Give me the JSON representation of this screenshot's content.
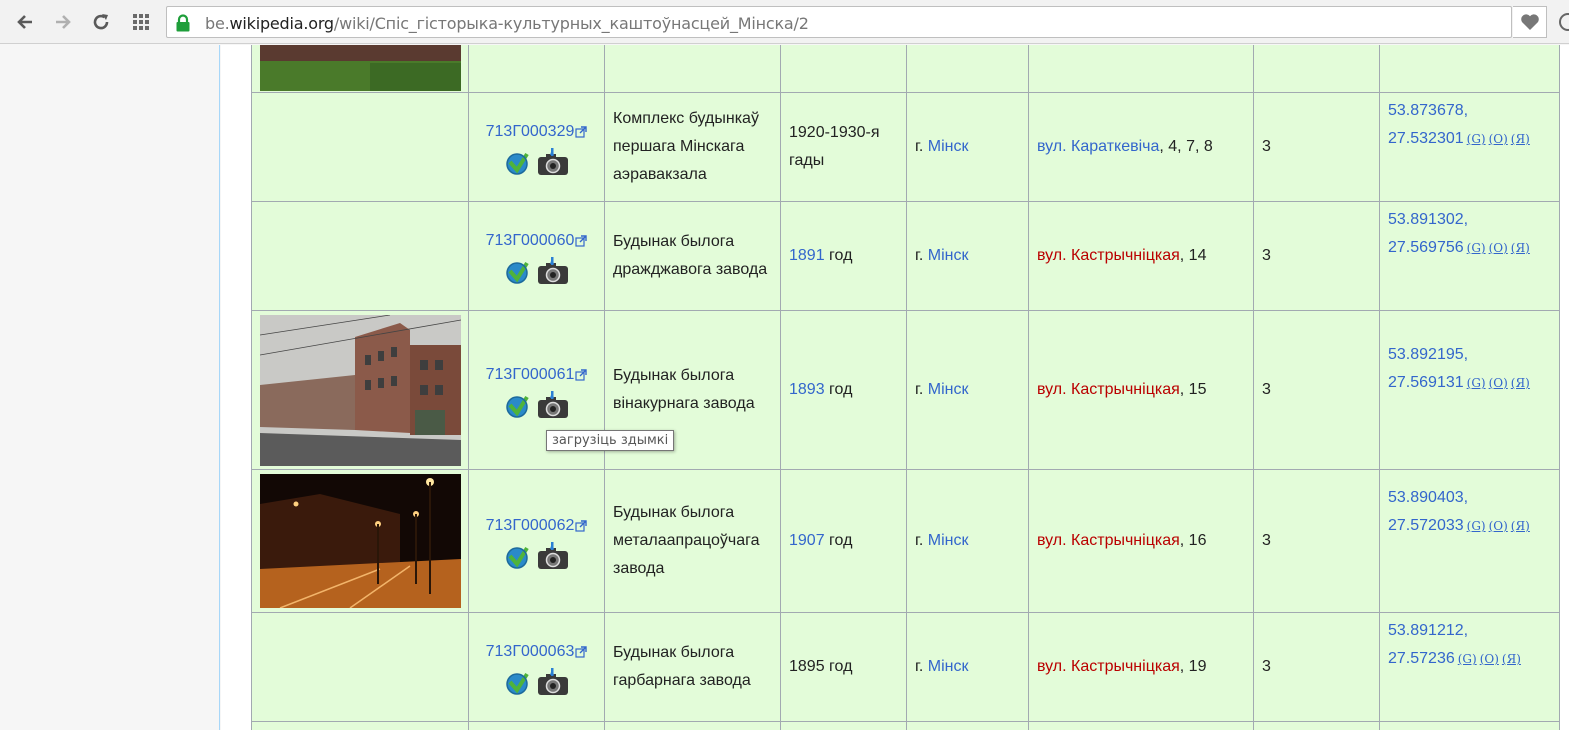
{
  "browser": {
    "url_prefix": "be.",
    "url_domain": "wikipedia.org",
    "url_path": "/wiki/Спіс_гісторыка-культурных_каштоўнасцей_Мінска/2"
  },
  "tooltip": "загрузіць здымкі",
  "coord_links": {
    "g": "(G)",
    "o": "(O)",
    "y": "(Я)"
  },
  "rows": [
    {
      "id": "713Г000329",
      "name": "Комплекс будынкаў першага Мінскага аэравакзала",
      "date_link": "",
      "date_text": "1920-1930-я гады",
      "city_prefix": "г. ",
      "city": "Мінск",
      "street": "вул. Караткевіча",
      "number": ", 4, 7, 8",
      "category": "3",
      "lat": "53.873678,",
      "lon": "27.532301"
    },
    {
      "id": "713Г000060",
      "name": "Будынак былога дражджавога завода",
      "date_link": "1891",
      "date_text": " год",
      "city_prefix": "г. ",
      "city": "Мінск",
      "street": "вул. Кастрычніцкая",
      "number": ", 14",
      "category": "3",
      "lat": "53.891302,",
      "lon": "27.569756"
    },
    {
      "id": "713Г000061",
      "name": "Будынак былога вінакурнага завода",
      "date_link": "1893",
      "date_text": " год",
      "city_prefix": "г. ",
      "city": "Мінск",
      "street": "вул. Кастрычніцкая",
      "number": ", 15",
      "category": "3",
      "lat": "53.892195,",
      "lon": "27.569131"
    },
    {
      "id": "713Г000062",
      "name": "Будынак былога металаапрацоўчага завода",
      "date_link": "1907",
      "date_text": " год",
      "city_prefix": "г. ",
      "city": "Мінск",
      "street": "вул. Кастрычніцкая",
      "number": ", 16",
      "category": "3",
      "lat": "53.890403,",
      "lon": "27.572033"
    },
    {
      "id": "713Г000063",
      "name": "Будынак былога гарбарнага завода",
      "date_link": "",
      "date_text": "1895 год",
      "city_prefix": "г. ",
      "city": "Мінск",
      "street": "вул. Кастрычніцкая",
      "number": ", 19",
      "category": "3",
      "lat": "53.891212,",
      "lon": "27.57236"
    }
  ]
}
